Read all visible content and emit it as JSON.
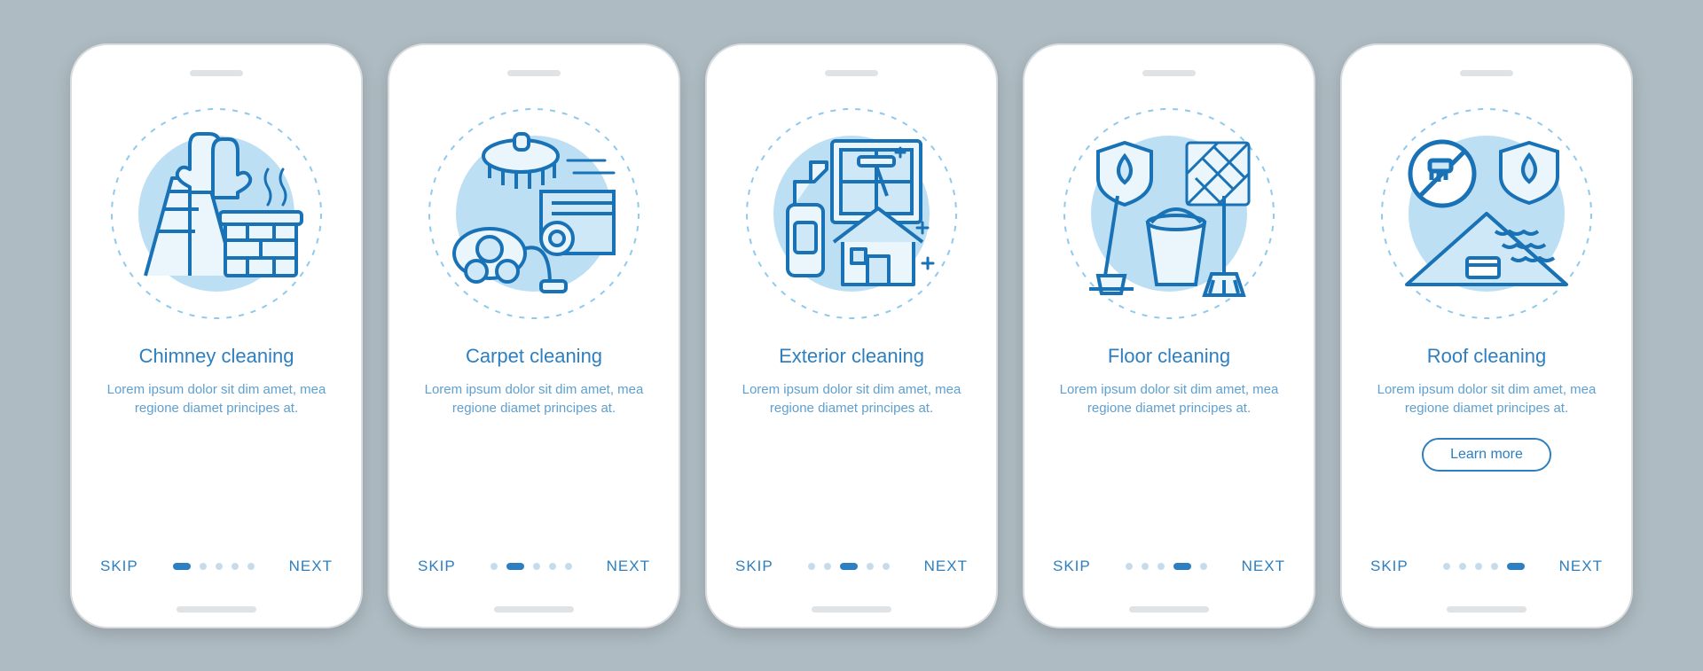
{
  "colors": {
    "primary": "#2d7fbf",
    "light": "#7fc0e8",
    "bg_circle": "#8fc9ec",
    "stroke": "#1872b5"
  },
  "common": {
    "skip_label": "SKIP",
    "next_label": "NEXT",
    "learn_more_label": "Learn more",
    "description": "Lorem ipsum dolor sit dim amet, mea regione diamet principes at.",
    "total_screens": 5
  },
  "screens": [
    {
      "title": "Chimney cleaning",
      "active_index": 0,
      "has_learn_more": false,
      "icon": "chimney-cleaning-icon"
    },
    {
      "title": "Carpet cleaning",
      "active_index": 1,
      "has_learn_more": false,
      "icon": "carpet-cleaning-icon"
    },
    {
      "title": "Exterior cleaning",
      "active_index": 2,
      "has_learn_more": false,
      "icon": "exterior-cleaning-icon"
    },
    {
      "title": "Floor cleaning",
      "active_index": 3,
      "has_learn_more": false,
      "icon": "floor-cleaning-icon"
    },
    {
      "title": "Roof cleaning",
      "active_index": 4,
      "has_learn_more": true,
      "icon": "roof-cleaning-icon"
    }
  ]
}
